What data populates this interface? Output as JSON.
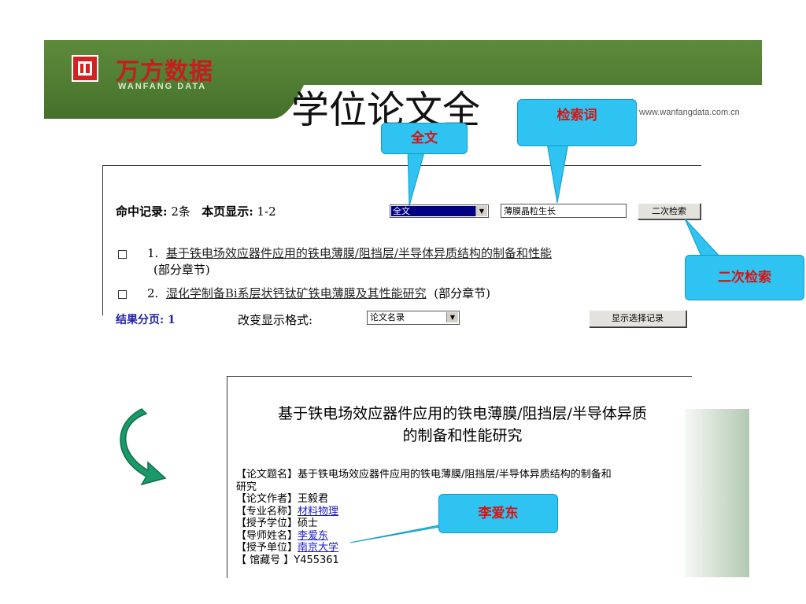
{
  "header": {
    "logo_cn": "万方数据",
    "logo_en": "WANFANG DATA",
    "title": "学位论文全",
    "url": "www.wanfangdata.com.cn"
  },
  "search": {
    "hit_label": "命中记录:",
    "hit_value": "2条",
    "page_label": "本页显示:",
    "page_value": "1-2",
    "field_select": "全文",
    "keyword": "薄膜晶粒生长",
    "second_search": "二次检索"
  },
  "results": [
    {
      "index": "1.",
      "title": "基于铁电场效应器件应用的铁电薄膜/阻挡层/半导体异质结构的制备和性能",
      "note": "(部分章节)"
    },
    {
      "index": "2.",
      "title": "湿化学制备Bi系层状钙钛矿铁电薄膜及其性能研究",
      "note": "(部分章节)"
    }
  ],
  "pagination": {
    "label": "结果分页:",
    "value": "1",
    "format_label": "改变显示格式:",
    "format_value": "论文名录",
    "show_button": "显示选择记录"
  },
  "detail": {
    "title": "基于铁电场效应器件应用的铁电薄膜/阻挡层/半导体异质的制备和性能研究",
    "title_line1": "基于铁电场效应器件应用的铁电薄膜/阻挡层/半导体异质",
    "title_line2": "的制备和性能研究",
    "fields": {
      "title_label": "【论文题名】",
      "title_value": "基于铁电场效应器件应用的铁电薄膜/阻挡层/半导体异质结构的制备和",
      "title_value_cont": "研究",
      "author_label": "【论文作者】",
      "author_value": "王毅君",
      "major_label": "【专业名称】",
      "major_value": "材料物理",
      "degree_label": "【授予学位】",
      "degree_value": "硕士",
      "advisor_label": "【导师姓名】",
      "advisor_value": "李爱东",
      "unit_label": "【授予单位】",
      "unit_value": "南京大学",
      "call_label": "【 馆藏号 】",
      "call_value": "Y455361"
    }
  },
  "callouts": {
    "fulltext": "全文",
    "keyword": "检索词",
    "second_search": "二次检索",
    "advisor": "李爱东"
  },
  "colors": {
    "banner": "#4f7c32",
    "callout_bg": "#2fc3f2",
    "callout_text": "#d9120f",
    "arrow": "#1a9a6a"
  }
}
